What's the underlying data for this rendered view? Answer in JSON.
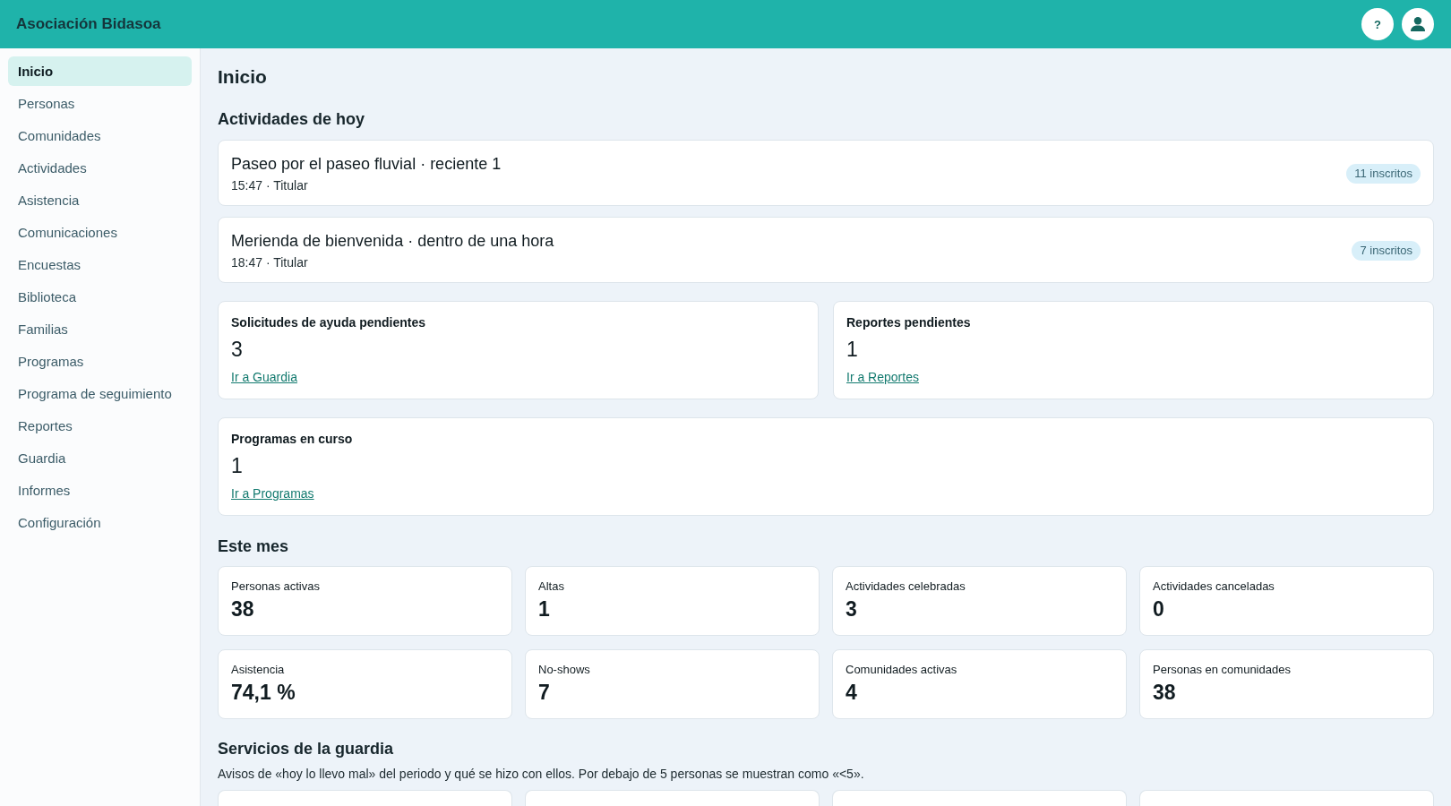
{
  "header": {
    "title": "Asociación Bidasoa",
    "help_button": "?"
  },
  "sidebar": {
    "items": [
      {
        "label": "Inicio",
        "selected": true
      },
      {
        "label": "Personas",
        "selected": false
      },
      {
        "label": "Comunidades",
        "selected": false
      },
      {
        "label": "Actividades",
        "selected": false
      },
      {
        "label": "Asistencia",
        "selected": false
      },
      {
        "label": "Comunicaciones",
        "selected": false
      },
      {
        "label": "Encuestas",
        "selected": false
      },
      {
        "label": "Biblioteca",
        "selected": false
      },
      {
        "label": "Familias",
        "selected": false
      },
      {
        "label": "Programas",
        "selected": false
      },
      {
        "label": "Programa de seguimiento",
        "selected": false
      },
      {
        "label": "Reportes",
        "selected": false
      },
      {
        "label": "Guardia",
        "selected": false
      },
      {
        "label": "Informes",
        "selected": false
      },
      {
        "label": "Configuración",
        "selected": false
      }
    ]
  },
  "main": {
    "title": "Inicio",
    "today": {
      "heading": "Actividades de hoy",
      "activities": [
        {
          "title": "Paseo por el paseo fluvial · reciente 1",
          "subtitle": "15:47 · Titular",
          "badge": "11 inscritos"
        },
        {
          "title": "Merienda de bienvenida · dentro de una hora",
          "subtitle": "18:47 · Titular",
          "badge": "7 inscritos"
        }
      ]
    },
    "pending": {
      "rows": [
        {
          "cards": [
            {
              "label": "Solicitudes de ayuda pendientes",
              "value": "3",
              "link": "Ir a Guardia"
            },
            {
              "label": "Reportes pendientes",
              "value": "1",
              "link": "Ir a Reportes"
            }
          ]
        },
        {
          "cards": [
            {
              "label": "Programas en curso",
              "value": "1",
              "link": "Ir a Programas"
            }
          ]
        }
      ]
    },
    "month": {
      "heading": "Este mes",
      "stats": [
        {
          "label": "Personas activas",
          "value": "38"
        },
        {
          "label": "Altas",
          "value": "1"
        },
        {
          "label": "Actividades celebradas",
          "value": "3"
        },
        {
          "label": "Actividades canceladas",
          "value": "0"
        },
        {
          "label": "Asistencia",
          "value": "74,1 %"
        },
        {
          "label": "No-shows",
          "value": "7"
        },
        {
          "label": "Comunidades activas",
          "value": "4"
        },
        {
          "label": "Personas en comunidades",
          "value": "38"
        }
      ]
    },
    "guard": {
      "heading": "Servicios de la guardia",
      "description": "Avisos de «hoy lo llevo mal» del periodo y qué se hizo con ellos. Por debajo de 5 personas se muestran como «<5».",
      "cards": [
        {
          "kind": "stat"
        },
        {
          "kind": "stat"
        },
        {
          "kind": "stat"
        },
        {
          "kind": "stat"
        }
      ]
    }
  }
}
